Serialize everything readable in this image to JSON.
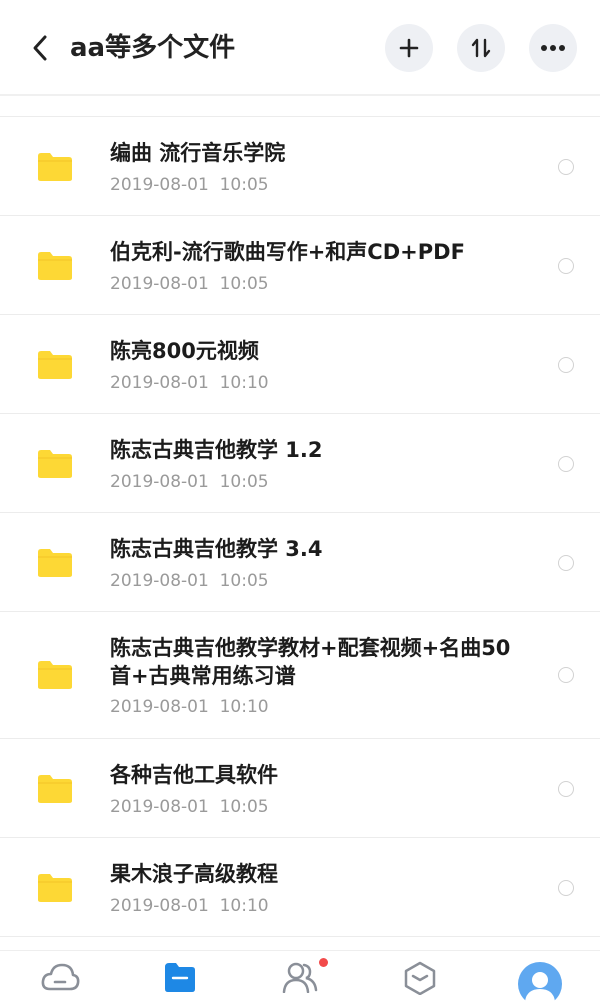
{
  "header": {
    "title": "aa等多个文件",
    "icons": {
      "back": "chevron-left-icon",
      "add": "plus-icon",
      "sort": "sort-icon",
      "more": "more-dots-icon"
    }
  },
  "files": [
    {
      "name": "编曲 流行音乐学院",
      "date": "2019-08-01  10:05"
    },
    {
      "name": "伯克利-流行歌曲写作+和声CD+PDF",
      "date": "2019-08-01  10:05"
    },
    {
      "name": "陈亮800元视频",
      "date": "2019-08-01  10:10"
    },
    {
      "name": "陈志古典吉他教学 1.2",
      "date": "2019-08-01  10:05"
    },
    {
      "name": "陈志古典吉他教学 3.4",
      "date": "2019-08-01  10:05"
    },
    {
      "name": "陈志古典吉他教学教材+配套视频+名曲50首+古典常用练习谱",
      "date": "2019-08-01  10:10"
    },
    {
      "name": "各种吉他工具软件",
      "date": "2019-08-01  10:05"
    },
    {
      "name": "果木浪子高级教程",
      "date": "2019-08-01  10:10"
    }
  ],
  "tabbar": {
    "items": [
      "cloud-icon",
      "folder-icon",
      "people-icon",
      "cube-icon",
      "avatar-icon"
    ],
    "active_index": 1,
    "badge_on": 2
  },
  "colors": {
    "folder": "#FDD835",
    "active_tab": "#1E88E5",
    "badge": "#F24A4A"
  }
}
